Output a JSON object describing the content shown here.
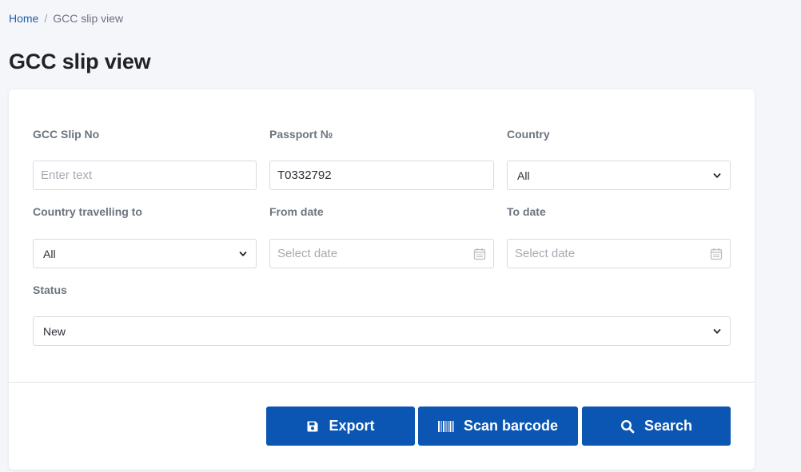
{
  "breadcrumb": {
    "home": "Home",
    "separator": "/",
    "current": "GCC slip view"
  },
  "page_title": "GCC slip view",
  "filters": {
    "gcc_slip_no": {
      "label": "GCC Slip No",
      "placeholder": "Enter text",
      "value": ""
    },
    "passport": {
      "label": "Passport №",
      "value": "T0332792"
    },
    "country": {
      "label": "Country",
      "selected": "All"
    },
    "country_travelling_to": {
      "label": "Country travelling to",
      "selected": "All"
    },
    "from_date": {
      "label": "From date",
      "placeholder": "Select date",
      "icon": "calendar-icon"
    },
    "to_date": {
      "label": "To date",
      "placeholder": "Select date",
      "icon": "calendar-icon"
    },
    "status": {
      "label": "Status",
      "selected": "New"
    }
  },
  "actions": {
    "export": {
      "label": "Export",
      "icon": "save-icon"
    },
    "scan_barcode": {
      "label": "Scan barcode",
      "icon": "barcode-icon"
    },
    "search": {
      "label": "Search",
      "icon": "search-icon"
    }
  },
  "colors": {
    "primary": "#0a56b2",
    "link": "#1e5fa8",
    "background": "#f5f6fa"
  }
}
